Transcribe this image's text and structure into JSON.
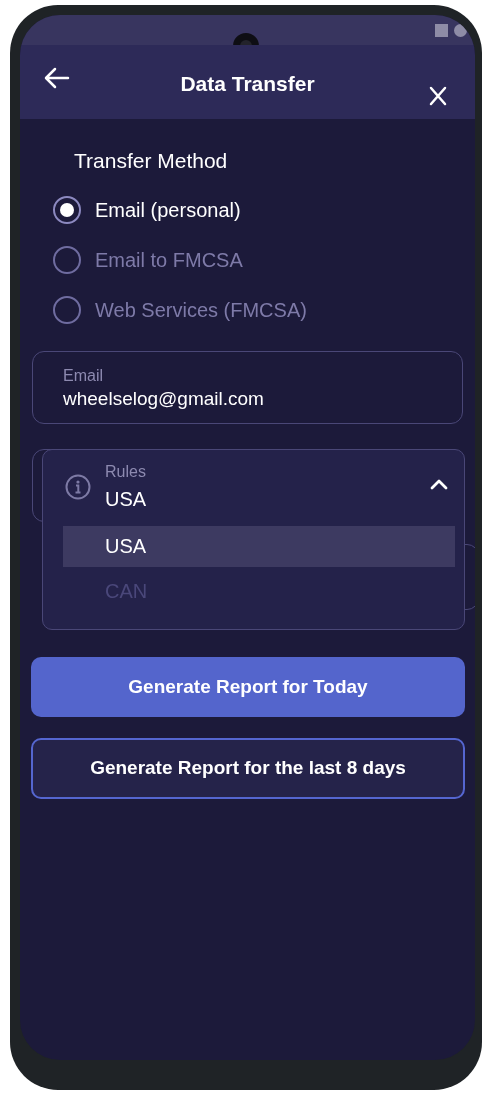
{
  "header": {
    "title": "Data Transfer"
  },
  "section_title": "Transfer Method",
  "methods": [
    {
      "label": "Email (personal)",
      "selected": true
    },
    {
      "label": "Email to FMCSA",
      "selected": false
    },
    {
      "label": "Web Services (FMCSA)",
      "selected": false
    }
  ],
  "email_field": {
    "label": "Email",
    "value": "wheelselog@gmail.com"
  },
  "rules_dropdown": {
    "label": "Rules",
    "value": "USA",
    "expanded": true,
    "options": [
      {
        "label": "USA",
        "selected": true
      },
      {
        "label": "CAN",
        "selected": false
      }
    ]
  },
  "buttons": [
    {
      "label": "Generate Report for Today",
      "kind": "primary"
    },
    {
      "label": "Generate Report for the last 8 days",
      "kind": "outline"
    }
  ]
}
